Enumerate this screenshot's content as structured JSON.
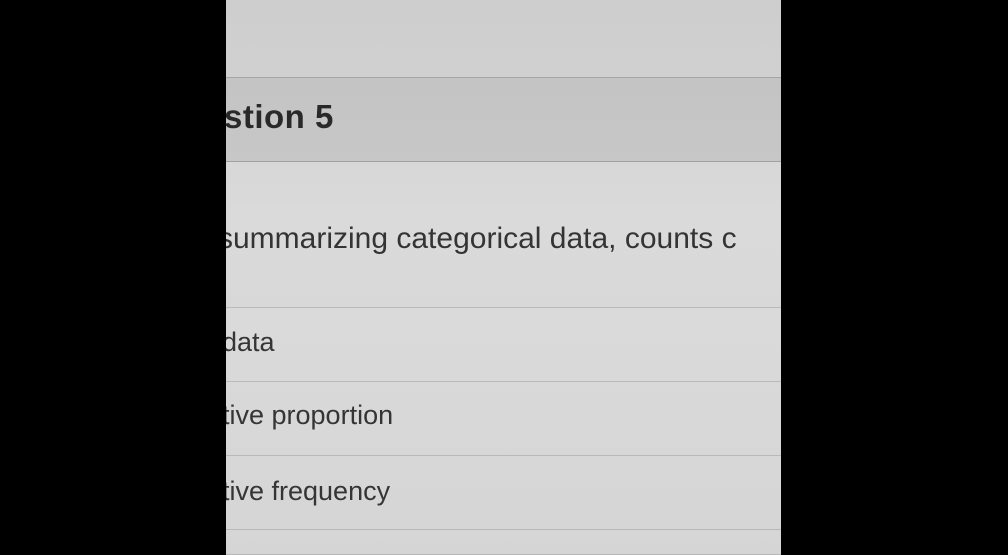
{
  "question": {
    "title": "stion 5",
    "text": "summarizing categorical data, counts c"
  },
  "options": [
    {
      "label": "data"
    },
    {
      "label": "tive proportion"
    },
    {
      "label": "tive frequency"
    }
  ],
  "colors": {
    "background": "#000000",
    "panel": "#d9d9d9",
    "header": "#c9c9c9",
    "text": "#2f2f2f"
  }
}
